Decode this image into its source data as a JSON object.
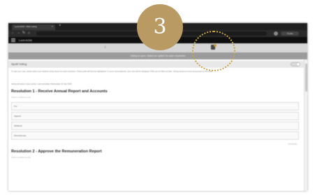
{
  "browser": {
    "tab_title": "Lumi AGM - Web voting",
    "tab_close_icon": "close-icon",
    "new_tab_label": "+",
    "back_label": "←",
    "forward_label": "→",
    "reload_label": "↻",
    "home_label": "⌂",
    "profile_label": "Profile"
  },
  "app": {
    "title": "Lumi AGM"
  },
  "subnav": {
    "left_label": "i",
    "middle_label": "▭",
    "document_icon": "document-icon"
  },
  "banner": {
    "text": "Voting is open. Select an option for each resolution"
  },
  "spoilt_voting": {
    "label": "Spoilt Voting"
  },
  "intro": {
    "text": "To cast your vote, please select your desired voting choice for each resolution. Online polls will then be highlighted. In some circumstances, your vote will be displayed. Polls can be filled out later. Voting closes at a time announced by the Chair.",
    "note": "Voting will close in due course. Last submitted: Wednesday 16 July 2025"
  },
  "resolutions": [
    {
      "title": "Resolution 1 - Receive Annual Report and Accounts",
      "subtitle": "Select a choice to vote",
      "options": [
        "For",
        "Against",
        "Withheld",
        "Discretionary"
      ],
      "cancel_label": "CANCEL"
    },
    {
      "title": "Resolution 2 - Approve the Remuneration Report",
      "subtitle": "Select a choice to vote"
    }
  ],
  "overlay": {
    "step_number": "3"
  },
  "colors": {
    "badge": "#b89a62",
    "ring": "#c8a54a",
    "app_bar": "#0f0f0f"
  }
}
